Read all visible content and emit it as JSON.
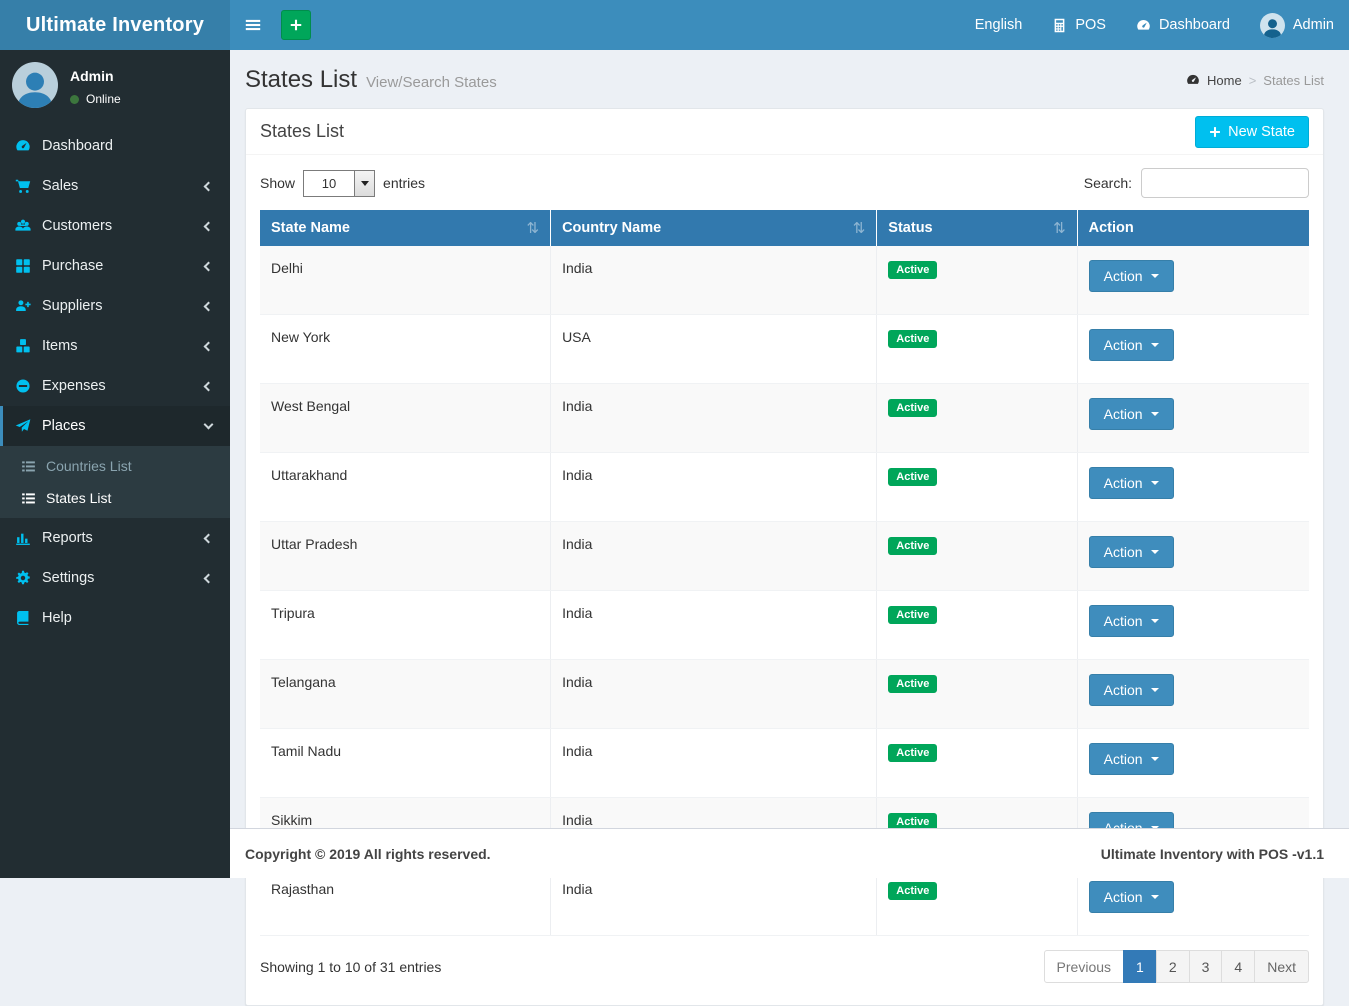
{
  "colors": {
    "navbar_blue": "#3c8dbc",
    "logo_blue": "#367fa9",
    "sidebar_dark": "#222d32",
    "submenu_dark": "#2c3b41",
    "active_item_border": "#3c8dbc",
    "sidebar_icon_cyan": "#00c0ef",
    "new_button_cyan": "#00c0ef",
    "success_green": "#00a65a",
    "table_header_blue": "#3279ae",
    "action_button_blue": "#3f8dbd",
    "pagination_active_blue": "#337ab7",
    "content_background": "#ecf0f5",
    "online_dot_green": "#3c763d"
  },
  "navbar": {
    "brand": "Ultimate Inventory",
    "menu": [
      {
        "label": "English"
      },
      {
        "label": "POS",
        "icon": "calculator-icon"
      },
      {
        "label": "Dashboard",
        "icon": "dashboard-icon"
      },
      {
        "label": "Admin",
        "icon": "user-avatar"
      }
    ]
  },
  "sidebar": {
    "user": {
      "name": "Admin",
      "status": "Online"
    },
    "menu": [
      {
        "label": "Dashboard",
        "icon": "tachometer-icon"
      },
      {
        "label": "Sales",
        "icon": "cart-icon",
        "chevron": "left"
      },
      {
        "label": "Customers",
        "icon": "users-icon",
        "chevron": "left"
      },
      {
        "label": "Purchase",
        "icon": "grid-icon",
        "chevron": "left"
      },
      {
        "label": "Suppliers",
        "icon": "user-plus-icon",
        "chevron": "left"
      },
      {
        "label": "Items",
        "icon": "cubes-icon",
        "chevron": "left"
      },
      {
        "label": "Expenses",
        "icon": "minus-circle-icon",
        "chevron": "left"
      },
      {
        "label": "Places",
        "icon": "paper-plane-icon",
        "chevron": "down",
        "active": true
      },
      {
        "label": "Reports",
        "icon": "bar-chart-icon",
        "chevron": "left"
      },
      {
        "label": "Settings",
        "icon": "gears-icon",
        "chevron": "left"
      },
      {
        "label": "Help",
        "icon": "book-icon"
      }
    ],
    "places_submenu": [
      {
        "label": "Countries List",
        "active": false
      },
      {
        "label": "States List",
        "active": true
      }
    ]
  },
  "page": {
    "title": "States List",
    "subtitle": "View/Search States",
    "breadcrumb": {
      "home": "Home",
      "separator": ">",
      "current": "States List"
    }
  },
  "panel": {
    "title": "States List",
    "new_button": "New State",
    "show_label": "Show",
    "entries_label": "entries",
    "page_length": "10",
    "search_label": "Search:",
    "search_value": ""
  },
  "icons": {
    "sort_glyph": "⇅"
  },
  "table": {
    "columns": [
      {
        "label": "State Name",
        "sortable": true
      },
      {
        "label": "Country Name",
        "sortable": true
      },
      {
        "label": "Status",
        "sortable": true
      },
      {
        "label": "Action",
        "sortable": false
      }
    ],
    "action_label": "Action",
    "rows": [
      {
        "state": "Delhi",
        "country": "India",
        "status": "Active"
      },
      {
        "state": "New York",
        "country": "USA",
        "status": "Active"
      },
      {
        "state": "West Bengal",
        "country": "India",
        "status": "Active"
      },
      {
        "state": "Uttarakhand",
        "country": "India",
        "status": "Active"
      },
      {
        "state": "Uttar Pradesh",
        "country": "India",
        "status": "Active"
      },
      {
        "state": "Tripura",
        "country": "India",
        "status": "Active"
      },
      {
        "state": "Telangana",
        "country": "India",
        "status": "Active"
      },
      {
        "state": "Tamil Nadu",
        "country": "India",
        "status": "Active"
      },
      {
        "state": "Sikkim",
        "country": "India",
        "status": "Active"
      },
      {
        "state": "Rajasthan",
        "country": "India",
        "status": "Active"
      }
    ],
    "info": "Showing 1 to 10 of 31 entries",
    "pagination": {
      "previous": "Previous",
      "pages": [
        "1",
        "2",
        "3",
        "4"
      ],
      "active_page": "1",
      "next": "Next"
    }
  },
  "footer": {
    "left": "Copyright © 2019 All rights reserved.",
    "right": "Ultimate Inventory with POS -v1.1"
  }
}
